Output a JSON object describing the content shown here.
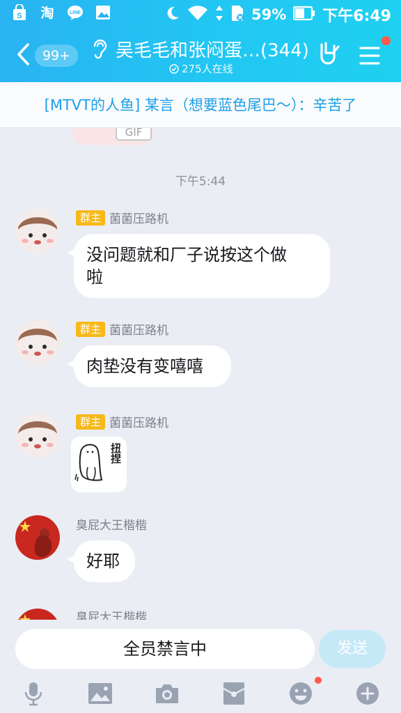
{
  "status_bar": {
    "battery": "59%",
    "time": "下午6:49",
    "left_icons": [
      "shopping-bag-icon",
      "taobao-icon",
      "line-icon",
      "gallery-icon"
    ],
    "right_icons": [
      "moon-icon",
      "wifi-icon",
      "data-arrows-icon",
      "sim-icon",
      "battery-icon"
    ]
  },
  "header": {
    "back_badge": "99+",
    "title": "吴毛毛和张闷蛋…(344)",
    "online": "275人在线",
    "accent": "#29b3f2"
  },
  "notice": "[MTVT的人鱼] 某言（想要蓝色尾巴～）：辛苦了",
  "chat": {
    "timestamp": "下午5:44",
    "prev_sticker_tag": "GIF",
    "messages": [
      {
        "role": "群主",
        "sender": "菌菌压路机",
        "text": "没问题就和厂子说按这个做\n啦"
      },
      {
        "role": "群主",
        "sender": "菌菌压路机",
        "text": "肉垫没有变嘻嘻"
      },
      {
        "role": "群主",
        "sender": "菌菌压路机",
        "sticker_text": "扭捏"
      },
      {
        "role": "",
        "sender": "臭屁大王楷楷",
        "text": "好耶"
      },
      {
        "role": "",
        "sender": "臭屁大王楷楷"
      }
    ]
  },
  "input": {
    "placeholder": "全员禁言中",
    "send_label": "发送"
  },
  "toolbar": [
    "mic-icon",
    "image-icon",
    "camera-icon",
    "red-packet-icon",
    "emoji-icon",
    "plus-icon"
  ],
  "colors": {
    "tag": "#f7b81a",
    "notice_text": "#1f9fe6",
    "dot": "#ff5a4a"
  }
}
